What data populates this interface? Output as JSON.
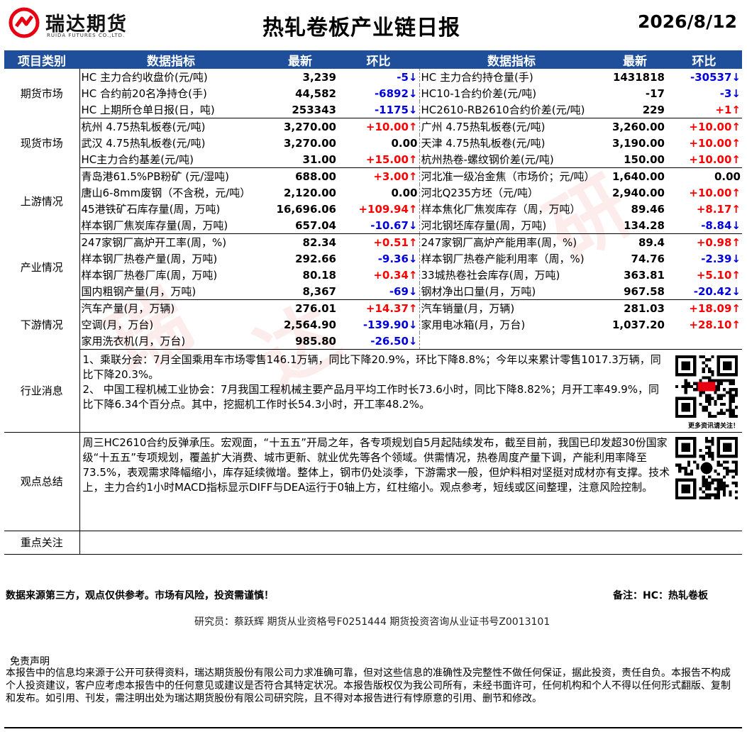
{
  "header": {
    "logo_cn": "瑞达期货",
    "logo_en": "RUIDA FUTURES CO.,LTD.",
    "title": "热轧卷板产业链日报",
    "date": "2026/8/12"
  },
  "table_head": [
    "项目类别",
    "数据指标",
    "最新",
    "环比",
    "数据指标",
    "最新",
    "环比"
  ],
  "groups": [
    {
      "category": "期货市场",
      "rows": [
        {
          "l": {
            "name": "HC 主力合约收盘价(元/吨)",
            "val": "3,239",
            "chg": "-5↓",
            "dir": "down"
          },
          "r": {
            "name": "HC 主力合约持仓量(手)",
            "val": "1431818",
            "chg": "-30537↓",
            "dir": "down"
          }
        },
        {
          "l": {
            "name": "HC 合约前20名净持仓(手)",
            "val": "44,582",
            "chg": "-6892↓",
            "dir": "down"
          },
          "r": {
            "name": "HC10-1合约价差(元/吨)",
            "val": "-17",
            "chg": "-3↓",
            "dir": "down"
          }
        },
        {
          "l": {
            "name": "HC 上期所仓单日报(日，吨)",
            "val": "253343",
            "chg": "-1175↓",
            "dir": "down"
          },
          "r": {
            "name": "HC2610-RB2610合约价差(元/吨)",
            "val": "229",
            "chg": "+1↑",
            "dir": "up"
          }
        }
      ]
    },
    {
      "category": "现货市场",
      "rows": [
        {
          "l": {
            "name": "杭州 4.75热轧板卷(元/吨)",
            "val": "3,270.00",
            "chg": "+10.00↑",
            "dir": "up"
          },
          "r": {
            "name": "广州 4.75热轧板卷(元/吨)",
            "val": "3,260.00",
            "chg": "+10.00↑",
            "dir": "up"
          }
        },
        {
          "l": {
            "name": "武汉 4.75热轧板卷(元/吨)",
            "val": "3,270.00",
            "chg": "0.00",
            "dir": "flat"
          },
          "r": {
            "name": "天津 4.75热轧板卷(元/吨)",
            "val": "3,190.00",
            "chg": "+10.00↑",
            "dir": "up"
          }
        },
        {
          "l": {
            "name": "HC主力合约基差(元/吨)",
            "val": "31.00",
            "chg": "+15.00↑",
            "dir": "up"
          },
          "r": {
            "name": "杭州热卷-螺纹钢价差(元/吨)",
            "val": "150.00",
            "chg": "+10.00↑",
            "dir": "up"
          }
        }
      ]
    },
    {
      "category": "上游情况",
      "rows": [
        {
          "l": {
            "name": "青岛港61.5%PB粉矿 (元/湿吨)",
            "val": "688.00",
            "chg": "+3.00↑",
            "dir": "up"
          },
          "r": {
            "name": "河北准一级冶金焦（市场价；元/吨）",
            "val": "1,640.00",
            "chg": "0.00",
            "dir": "flat"
          }
        },
        {
          "l": {
            "name": "唐山6-8mm废钢（不含税，元/吨）",
            "val": "2,120.00",
            "chg": "0.00",
            "dir": "flat"
          },
          "r": {
            "name": "河北Q235方坯（元/吨）",
            "val": "2,940.00",
            "chg": "+10.00↑",
            "dir": "up"
          }
        },
        {
          "l": {
            "name": "45港铁矿石库存量(周，万吨)",
            "val": "16,696.06",
            "chg": "+109.94↑",
            "dir": "up"
          },
          "r": {
            "name": "样本焦化厂焦炭库存（周，万吨）",
            "val": "89.46",
            "chg": "+8.17↑",
            "dir": "up"
          }
        },
        {
          "l": {
            "name": "样本钢厂焦炭库存量(周，万吨)",
            "val": "657.04",
            "chg": "-10.67↓",
            "dir": "down"
          },
          "r": {
            "name": "河北钢坯库存量(周，万吨)",
            "val": "134.28",
            "chg": "-8.84↓",
            "dir": "down"
          }
        }
      ]
    },
    {
      "category": "产业情况",
      "rows": [
        {
          "l": {
            "name": "247家钢厂高炉开工率(周，%)",
            "val": "82.34",
            "chg": "+0.51↑",
            "dir": "up"
          },
          "r": {
            "name": "247家钢厂高炉产能用率(周，%)",
            "val": "89.4",
            "chg": "+0.98↑",
            "dir": "up"
          }
        },
        {
          "l": {
            "name": "样本钢厂热卷产量(周，万吨)",
            "val": "292.66",
            "chg": "-9.36↓",
            "dir": "down"
          },
          "r": {
            "name": "样本钢厂热卷产能利用率（周，%)",
            "val": "74.76",
            "chg": "-2.39↓",
            "dir": "down"
          }
        },
        {
          "l": {
            "name": "样本钢厂热卷厂库(周，万吨)",
            "val": "80.18",
            "chg": "+0.34↑",
            "dir": "up"
          },
          "r": {
            "name": "33城热卷社会库存(周，万吨)",
            "val": "363.81",
            "chg": "+5.10↑",
            "dir": "up"
          }
        },
        {
          "l": {
            "name": "国内粗钢产量(月，万吨)",
            "val": "8,367",
            "chg": "-69↓",
            "dir": "down"
          },
          "r": {
            "name": "钢材净出口量(月，万吨)",
            "val": "967.58",
            "chg": "-20.42↓",
            "dir": "down"
          }
        }
      ]
    },
    {
      "category": "下游情况",
      "rows": [
        {
          "l": {
            "name": "汽车产量(月，万辆)",
            "val": "276.01",
            "chg": "+14.37↑",
            "dir": "up"
          },
          "r": {
            "name": "汽车销量(月，万辆)",
            "val": "281.03",
            "chg": "+18.09↑",
            "dir": "up"
          }
        },
        {
          "l": {
            "name": "空调(月，万台)",
            "val": "2,564.90",
            "chg": "-139.90↓",
            "dir": "down"
          },
          "r": {
            "name": "家用电冰箱(月，万台)",
            "val": "1,037.20",
            "chg": "+28.10↑",
            "dir": "up"
          }
        },
        {
          "l": {
            "name": "家用洗衣机(月，万台)",
            "val": "985.80",
            "chg": "-26.50↓",
            "dir": "down"
          },
          "r": {
            "name": "",
            "val": "",
            "chg": "",
            "dir": "flat"
          }
        }
      ]
    }
  ],
  "news": {
    "category": "行业消息",
    "text": "1、乘联分会：7月全国乘用车市场零售146.1万辆，同比下降20.9%，环比下降8.8%；今年以来累计零售1017.3万辆，同比下降20.3%。\n2、 中国工程机械工业协会：7月我国工程机械主要产品月平均工作时长73.6小时，同比下降8.82%；月开工率49.9%，同比下降6.34个百分点。其中，挖掘机工作时长54.3小时，开工率48.2%。",
    "qr_caption": "更多资讯请关注！"
  },
  "view": {
    "category": "观点总结",
    "text": "周三HC2610合约反弹承压。宏观面，“十五五”开局之年，各专项规划自5月起陆续发布，截至目前，我国已印发超30份国家级“十五五”专项规划，覆盖扩大消费、城市更新、就业优先等各个领域。供需情况，热卷周度产量下调，产能利用率降至73.5%，表观需求降幅缩小，库存延续微增。整体上，钢市仍处淡季，下游需求一般，但炉料相对坚挺对成材亦有支撑。技术上，主力合约1小时MACD指标显示DIFF与DEA运行于0轴上方，红柱缩小。观点参考，短线或区间整理，注意风险控制。"
  },
  "focus": {
    "category": "重点关注",
    "text": ""
  },
  "footer": {
    "source": "数据来源第三方，观点仅供参考。市场有风险，投资需谨慎！",
    "note": "备注：HC：热轧卷板",
    "researcher": "研究员：蔡跃辉    期货从业资格号F0251444    期货投资咨询从业证书号Z0013101",
    "disclaimer_title": "免责声明",
    "disclaimer": "本报告中的信息均来源于公开可获得资料，瑞达期货股份有限公司力求准确可靠，但对这些信息的准确性及完整性不做任何保证，据此投资，责任自负。本报告不构成个人投资建议，客户应考虑本报告中的任何意见或建议是否符合其特定状况。本报告版权仅为我公司所有，未经书面许可，任何机构和个人不得以任何形式翻版、复制和发布。如引用、刊发，需注明出处为瑞达期货股份有限公司研究院，且不得对本报告进行有悖原意的引用、删节和修改。"
  },
  "colors": {
    "header_bg": "#1F4E9B",
    "up": "#ff0000",
    "down": "#0000dd",
    "logo_red": "#E60012"
  }
}
